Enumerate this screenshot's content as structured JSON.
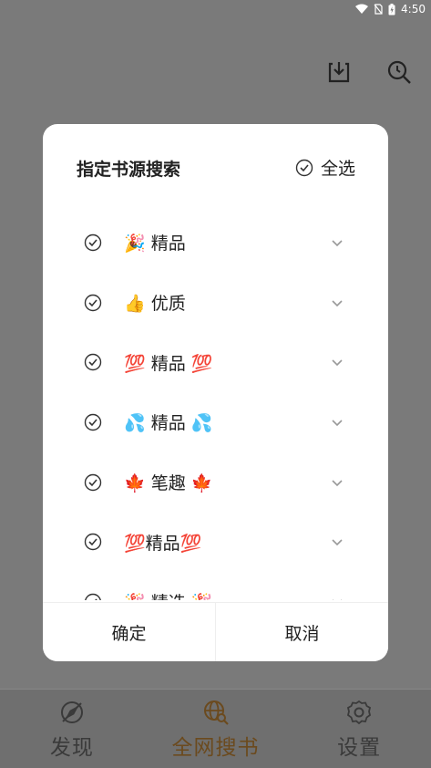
{
  "status_bar": {
    "time": "4:50"
  },
  "dialog": {
    "title": "指定书源搜索",
    "select_all_label": "全选",
    "groups": [
      {
        "label": "🎉 精品"
      },
      {
        "label": "👍 优质"
      },
      {
        "label": "💯 精品 💯"
      },
      {
        "label": "💦 精品 💦"
      },
      {
        "label": "🍁 笔趣 🍁"
      },
      {
        "label": "💯精品💯"
      },
      {
        "label": "🎉 精选 🎉"
      }
    ],
    "confirm_label": "确定",
    "cancel_label": "取消"
  },
  "bottom_nav": {
    "items": [
      {
        "label": "发现",
        "icon": "compass-icon"
      },
      {
        "label": "全网搜书",
        "icon": "globe-search-icon"
      },
      {
        "label": "设置",
        "icon": "gear-icon"
      }
    ],
    "active_index": 1
  },
  "colors": {
    "accent": "#6b4a1e",
    "overlay": "#7a7a7a",
    "dialog_bg": "#ffffff"
  }
}
